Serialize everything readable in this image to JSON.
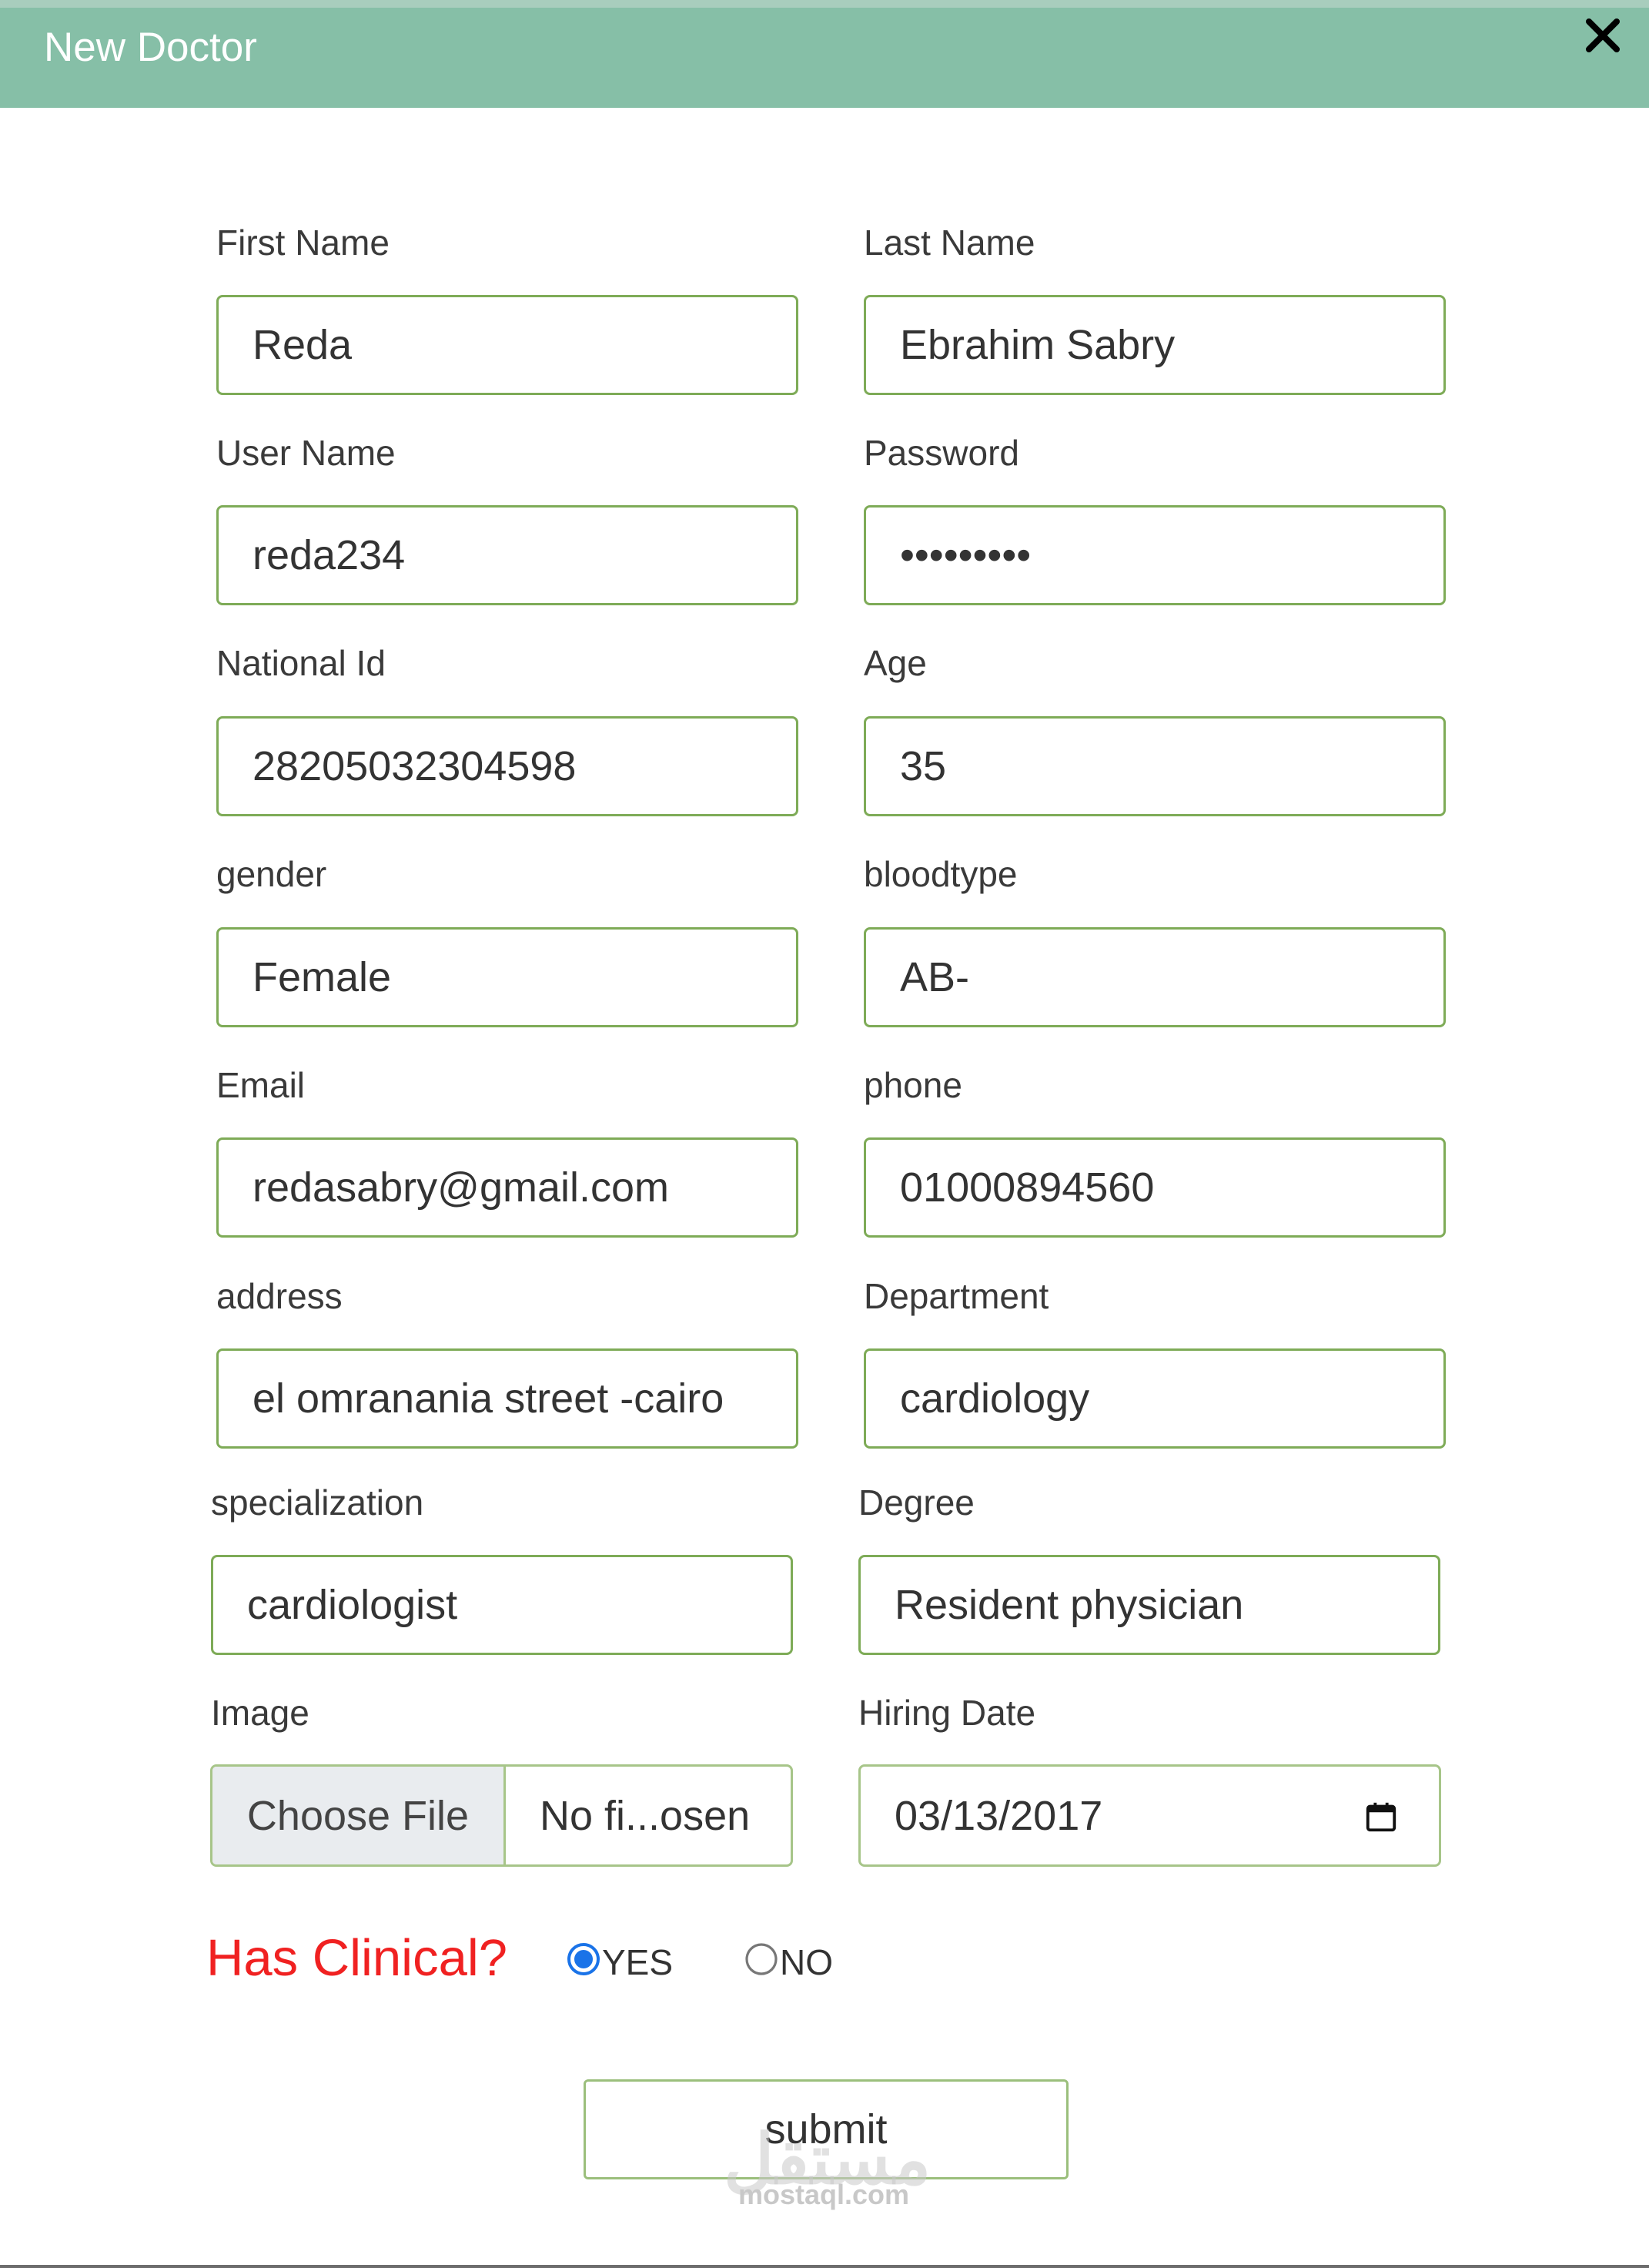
{
  "dialog": {
    "title": "New Doctor",
    "header_color": "#86bfa7"
  },
  "fields": {
    "first_name": {
      "label": "First Name",
      "value": "Reda"
    },
    "last_name": {
      "label": "Last Name",
      "value": "Ebrahim Sabry"
    },
    "user_name": {
      "label": "User Name",
      "value": "reda234"
    },
    "password": {
      "label": "Password",
      "value": "•••••••••"
    },
    "national_id": {
      "label": "National Id",
      "value": "28205032304598"
    },
    "age": {
      "label": "Age",
      "value": "35"
    },
    "gender": {
      "label": "gender",
      "value": "Female"
    },
    "bloodtype": {
      "label": "bloodtype",
      "value": "AB-"
    },
    "email": {
      "label": "Email",
      "value": "redasabry@gmail.com"
    },
    "phone": {
      "label": "phone",
      "value": "01000894560"
    },
    "address": {
      "label": "address",
      "value": "el omranania street -cairo"
    },
    "department": {
      "label": "Department",
      "value": "cardiology"
    },
    "specialization": {
      "label": "specialization",
      "value": "cardiologist"
    },
    "degree": {
      "label": "Degree",
      "value": "Resident physician"
    },
    "image": {
      "label": "Image",
      "button": "Choose File",
      "file_name": "No fi...osen"
    },
    "hiring_date": {
      "label": "Hiring Date",
      "value": "03/13/2017"
    }
  },
  "clinical": {
    "question": "Has Clinical?",
    "options": [
      {
        "label": "YES",
        "selected": true
      },
      {
        "label": "NO",
        "selected": false
      }
    ],
    "question_color": "#f02121"
  },
  "submit_label": "submit",
  "watermark": {
    "logo": "مستقل",
    "text": "mostaql.com"
  },
  "colors": {
    "field_border": "#7eab57"
  }
}
